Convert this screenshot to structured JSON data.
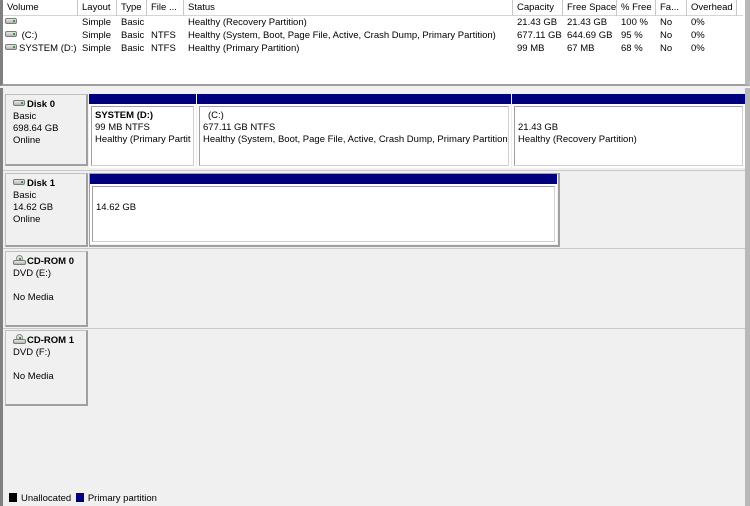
{
  "volume_list": {
    "columns": [
      "Volume",
      "Layout",
      "Type",
      "File ...",
      "Status",
      "Capacity",
      "Free Space",
      "% Free",
      "Fa...",
      "Overhead"
    ],
    "rows": [
      {
        "volume": "",
        "layout": "Simple",
        "type": "Basic",
        "fs": "",
        "status": "Healthy (Recovery Partition)",
        "capacity": "21.43 GB",
        "free": "21.43 GB",
        "pct_free": "100 %",
        "fault": "No",
        "overhead": "0%",
        "icon": "disk-icon"
      },
      {
        "volume": "(C:)",
        "layout": "Simple",
        "type": "Basic",
        "fs": "NTFS",
        "status": "Healthy (System, Boot, Page File, Active, Crash Dump, Primary Partition)",
        "capacity": "677.11 GB",
        "free": "644.69 GB",
        "pct_free": "95 %",
        "fault": "No",
        "overhead": "0%",
        "icon": "disk-icon"
      },
      {
        "volume": "SYSTEM (D:)",
        "layout": "Simple",
        "type": "Basic",
        "fs": "NTFS",
        "status": "Healthy (Primary Partition)",
        "capacity": "99 MB",
        "free": "67 MB",
        "pct_free": "68 %",
        "fault": "No",
        "overhead": "0%",
        "icon": "disk-icon"
      }
    ]
  },
  "disks": [
    {
      "name": "Disk 0",
      "type": "Basic",
      "size": "698.64 GB",
      "status": "Online",
      "icon": "disk-icon",
      "partitions": [
        {
          "name": "SYSTEM  (D:)",
          "size": "99 MB NTFS",
          "status": "Healthy (Primary Partit"
        },
        {
          "name": "(C:)",
          "size": "677.11 GB NTFS",
          "status": "Healthy (System, Boot, Page File, Active, Crash Dump, Primary Partition)"
        },
        {
          "name": "",
          "size": "21.43 GB",
          "status": "Healthy (Recovery Partition)"
        }
      ]
    },
    {
      "name": "Disk 1",
      "type": "Basic",
      "size": "14.62 GB",
      "status": "Online",
      "icon": "disk-icon",
      "partitions": [
        {
          "name": "",
          "size": "14.62 GB",
          "status": ""
        }
      ]
    },
    {
      "name": "CD-ROM 0",
      "type": "DVD (E:)",
      "size": "",
      "status": "No Media",
      "icon": "cdrom-icon",
      "partitions": []
    },
    {
      "name": "CD-ROM 1",
      "type": "DVD (F:)",
      "size": "",
      "status": "No Media",
      "icon": "cdrom-icon",
      "partitions": []
    }
  ],
  "legend": [
    {
      "label": "Unallocated",
      "color": "#000000"
    },
    {
      "label": "Primary partition",
      "color": "#00007f"
    }
  ]
}
